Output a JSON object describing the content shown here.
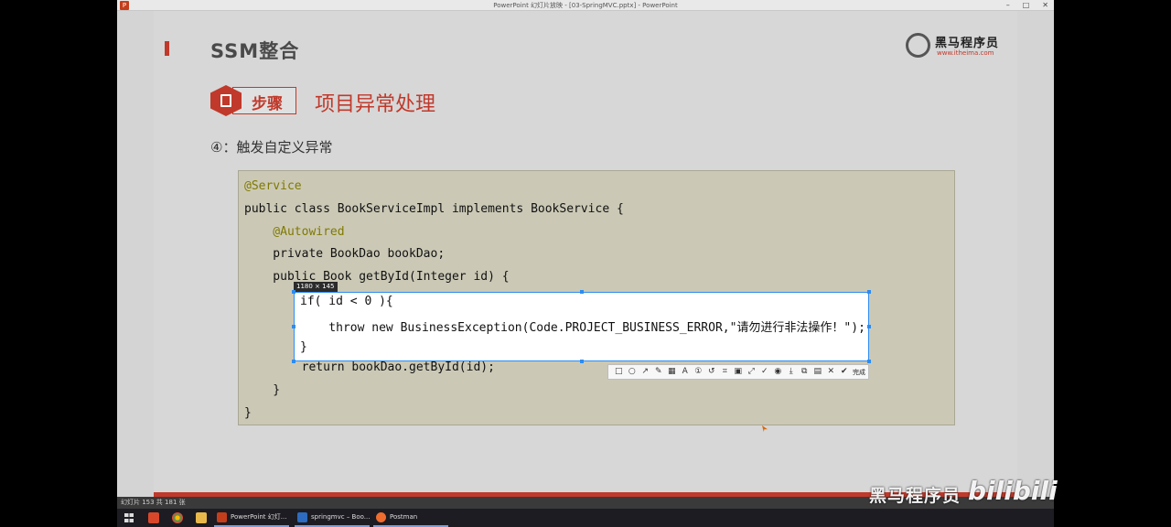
{
  "window": {
    "title": "PowerPoint 幻灯片放映 - [03-SpringMVC.pptx] - PowerPoint",
    "controls": [
      "–",
      "□",
      "✕"
    ]
  },
  "slide": {
    "title": "SSM整合",
    "logo": {
      "main": "黑马程序员",
      "url": "www.itheima.com"
    },
    "step_label": "步骤",
    "section_title": "项目异常处理",
    "subtitle": "④：触发自定义异常",
    "code": [
      {
        "text": "@Service",
        "style": "ann"
      },
      {
        "text": "public class BookServiceImpl implements BookService {",
        "style": "plain"
      },
      {
        "text": "    @Autowired",
        "style": "ann"
      },
      {
        "text": "    private BookDao bookDao;",
        "style": "plain"
      },
      {
        "text": "    public Book getById(Integer id) {",
        "style": "plain"
      },
      {
        "text": "",
        "style": "plain"
      },
      {
        "text": "",
        "style": "plain"
      },
      {
        "text": "",
        "style": "plain"
      },
      {
        "text": "        return bookDao.getById(id);",
        "style": "plain"
      },
      {
        "text": "    }",
        "style": "plain"
      },
      {
        "text": "}",
        "style": "plain"
      }
    ]
  },
  "screenshot_tool": {
    "dimensions": "1180 × 145",
    "code": [
      "if( id < 0 ){",
      "    throw new BusinessException(Code.PROJECT_BUSINESS_ERROR,\"请勿进行非法操作！\");",
      "}"
    ],
    "toolbar": {
      "icons": [
        "rectangle-icon",
        "ellipse-icon",
        "arrow-icon",
        "pencil-icon",
        "mosaic-icon",
        "text-icon",
        "number-icon",
        "undo-icon",
        "pin-icon",
        "ocr-icon",
        "scroll-icon",
        "pin2-icon",
        "record-icon",
        "download-icon",
        "copy-icon",
        "save-icon",
        "close-icon",
        "check-icon"
      ],
      "icon_glyphs": [
        "□",
        "○",
        "↗",
        "✎",
        "▦",
        "A",
        "①",
        "↺",
        "⌗",
        "▣",
        "⤢",
        "✓",
        "◉",
        "⤓",
        "⧉",
        "▤",
        "✕",
        "✔"
      ],
      "done_label": "完成"
    }
  },
  "statusbar": {
    "text": "幻灯片 153 共 181 张"
  },
  "watermark": {
    "text": "黑马程序员",
    "logo": "bilibili"
  },
  "taskbar": {
    "items": [
      {
        "label": "PowerPoint 幻灯...",
        "color": "#c43e1c"
      },
      {
        "label": "springmvc – Boo...",
        "color": "#2d6cc0"
      },
      {
        "label": "Postman",
        "color": "#ef6c2f"
      }
    ]
  }
}
